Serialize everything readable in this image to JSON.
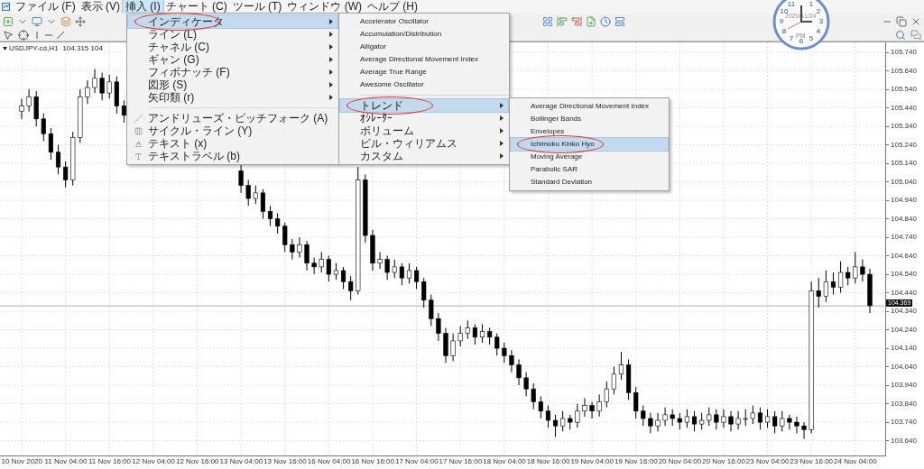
{
  "menubar": [
    {
      "label": "ファイル (F)",
      "selected": false
    },
    {
      "label": "表示 (V)",
      "selected": false
    },
    {
      "label": "挿入 (I)",
      "selected": true
    },
    {
      "label": "チャート (C)",
      "selected": false
    },
    {
      "label": "ツール (T)",
      "selected": false
    },
    {
      "label": "ウィンドウ (W)",
      "selected": false
    },
    {
      "label": "ヘルプ (H)",
      "selected": false
    }
  ],
  "insert_menu": [
    {
      "label": "インディケータ",
      "kind": "submenu",
      "selected": true,
      "circled": true
    },
    {
      "label": "ライン (L)",
      "kind": "submenu",
      "selected": false,
      "circled": false
    },
    {
      "label": "チャネル (C)",
      "kind": "submenu",
      "selected": false,
      "circled": false
    },
    {
      "label": "ギャン (G)",
      "kind": "submenu",
      "selected": false,
      "circled": false
    },
    {
      "label": "フィボナッチ (F)",
      "kind": "submenu",
      "selected": false,
      "circled": false
    },
    {
      "label": "図形 (S)",
      "kind": "submenu",
      "selected": false,
      "circled": false
    },
    {
      "label": "矢印類 (r)",
      "kind": "submenu",
      "selected": false,
      "circled": false
    },
    {
      "kind": "separator"
    },
    {
      "label": "アンドリューズ・ピッチフォーク (A)",
      "kind": "tool",
      "selected": false,
      "circled": false
    },
    {
      "label": "サイクル・ライン (Y)",
      "kind": "tool",
      "selected": false,
      "circled": false
    },
    {
      "label": "テキスト (x)",
      "kind": "tool",
      "selected": false,
      "circled": false
    },
    {
      "label": "テキストラベル (b)",
      "kind": "tool",
      "selected": false,
      "circled": false
    }
  ],
  "indicator_menu": [
    {
      "label": "Accelerator Oscillator",
      "kind": "item",
      "selected": false,
      "circled": false
    },
    {
      "label": "Accumulation/Distribution",
      "kind": "item",
      "selected": false,
      "circled": false
    },
    {
      "label": "Alligator",
      "kind": "item",
      "selected": false,
      "circled": false
    },
    {
      "label": "Average Directional Movement Index",
      "kind": "item",
      "selected": false,
      "circled": false
    },
    {
      "label": "Average True Range",
      "kind": "item",
      "selected": false,
      "circled": false
    },
    {
      "label": "Awesome Oscillator",
      "kind": "item",
      "selected": false,
      "circled": false
    },
    {
      "kind": "separator"
    },
    {
      "label": "トレンド",
      "kind": "submenu",
      "selected": true,
      "circled": true
    },
    {
      "label": "ｵｼﾚｰﾀｰ",
      "kind": "submenu",
      "selected": false,
      "circled": false
    },
    {
      "label": "ボリューム",
      "kind": "submenu",
      "selected": false,
      "circled": false
    },
    {
      "label": "ビル・ウィリアムス",
      "kind": "submenu",
      "selected": false,
      "circled": false
    },
    {
      "label": "カスタム",
      "kind": "submenu",
      "selected": false,
      "circled": false
    }
  ],
  "trend_menu": [
    {
      "label": "Average Directional Movement Index",
      "kind": "item",
      "selected": false,
      "circled": false
    },
    {
      "label": "Bollinger Bands",
      "kind": "item",
      "selected": false,
      "circled": false
    },
    {
      "label": "Envelopes",
      "kind": "item",
      "selected": false,
      "circled": false
    },
    {
      "label": "Ichimoku Kinko Hyo",
      "kind": "item",
      "selected": true,
      "circled": true
    },
    {
      "label": "Moving Average",
      "kind": "item",
      "selected": false,
      "circled": false
    },
    {
      "label": "Parabolic SAR",
      "kind": "item",
      "selected": false,
      "circled": false
    },
    {
      "label": "Standard Deviation",
      "kind": "item",
      "selected": false,
      "circled": false
    }
  ],
  "chart": {
    "symbol": "USDJPY-cd,H1",
    "prices": "104.315 104",
    "chart_data": {
      "type": "candlestick",
      "ylim": [
        103.56,
        105.794
      ],
      "grid": true,
      "ref_lines": [
        {
          "axis": "y",
          "value": 104.369,
          "label": "104.369",
          "color": "#999999"
        }
      ],
      "categories": [
        "10 Nov 2020",
        null,
        null,
        null,
        null,
        null,
        "11 Nov 04:00",
        null,
        null,
        null,
        null,
        null,
        "11 Nov 16:00",
        null,
        null,
        null,
        null,
        null,
        "12 Nov 04:00",
        null,
        null,
        null,
        null,
        null,
        "12 Nov 16:00",
        null,
        null,
        null,
        null,
        null,
        "13 Nov 04:00",
        null,
        null,
        null,
        null,
        null,
        "13 Nov 16:00",
        null,
        null,
        null,
        null,
        null,
        "16 Nov 04:00",
        null,
        null,
        null,
        null,
        null,
        "16 Nov 16:00",
        null,
        null,
        null,
        null,
        null,
        "17 Nov 04:00",
        null,
        null,
        null,
        null,
        null,
        "17 Nov 16:00",
        null,
        null,
        null,
        null,
        null,
        "18 Nov 04:00",
        null,
        null,
        null,
        null,
        null,
        "18 Nov 16:00",
        null,
        null,
        null,
        null,
        null,
        "19 Nov 04:00",
        null,
        null,
        null,
        null,
        null,
        "19 Nov 16:00",
        null,
        null,
        null,
        null,
        null,
        "20 Nov 04:00",
        null,
        null,
        null,
        null,
        null,
        "20 Nov 16:00",
        null,
        null,
        null,
        null,
        null,
        "23 Nov 04:00",
        null,
        null,
        null,
        null,
        null,
        "23 Nov 16:00",
        null,
        null,
        null,
        null,
        null,
        "24 Nov 04:00",
        null,
        null
      ],
      "yticks": [
        {
          "value": 105.74,
          "label": "105.740"
        },
        {
          "value": 105.64,
          "label": "105.640"
        },
        {
          "value": 105.54,
          "label": "105.540"
        },
        {
          "value": 105.44,
          "label": "105.440"
        },
        {
          "value": 105.34,
          "label": "105.340"
        },
        {
          "value": 105.24,
          "label": "105.240"
        },
        {
          "value": 105.14,
          "label": "105.140"
        },
        {
          "value": 105.04,
          "label": "105.040"
        },
        {
          "value": 104.94,
          "label": "104.940"
        },
        {
          "value": 104.84,
          "label": "104.840"
        },
        {
          "value": 104.74,
          "label": "104.740"
        },
        {
          "value": 104.64,
          "label": "104.640"
        },
        {
          "value": 104.54,
          "label": "104.540"
        },
        {
          "value": 104.44,
          "label": "104.440"
        },
        {
          "value": 104.34,
          "label": "104.340"
        },
        {
          "value": 104.24,
          "label": "104.240"
        },
        {
          "value": 104.14,
          "label": "104.140"
        },
        {
          "value": 104.04,
          "label": "104.040"
        },
        {
          "value": 103.94,
          "label": "103.940"
        },
        {
          "value": 103.84,
          "label": "103.840"
        },
        {
          "value": 103.74,
          "label": "103.740"
        },
        {
          "value": 103.64,
          "label": "103.640"
        }
      ],
      "ohlc": [
        [
          105.42,
          105.49,
          105.38,
          105.45
        ],
        [
          105.45,
          105.54,
          105.42,
          105.5
        ],
        [
          105.5,
          105.53,
          105.34,
          105.38
        ],
        [
          105.38,
          105.41,
          105.26,
          105.3
        ],
        [
          105.3,
          105.33,
          105.16,
          105.2
        ],
        [
          105.2,
          105.24,
          105.08,
          105.12
        ],
        [
          105.12,
          105.15,
          105.01,
          105.05
        ],
        [
          105.05,
          105.31,
          105.02,
          105.28
        ],
        [
          105.28,
          105.54,
          105.25,
          105.5
        ],
        [
          105.5,
          105.59,
          105.46,
          105.55
        ],
        [
          105.55,
          105.65,
          105.52,
          105.6
        ],
        [
          105.6,
          105.63,
          105.48,
          105.52
        ],
        [
          105.52,
          105.62,
          105.49,
          105.58
        ],
        [
          105.58,
          105.61,
          105.41,
          105.45
        ],
        [
          105.45,
          105.48,
          105.36,
          105.4
        ],
        null,
        null,
        null,
        null,
        null,
        null,
        null,
        null,
        null,
        null,
        null,
        null,
        null,
        null,
        null,
        [
          105.1,
          105.13,
          104.98,
          105.02
        ],
        [
          105.02,
          105.05,
          104.91,
          104.95
        ],
        [
          104.95,
          105.02,
          104.92,
          104.98
        ],
        [
          104.98,
          105.0,
          104.84,
          104.88
        ],
        [
          104.88,
          104.91,
          104.8,
          104.84
        ],
        [
          104.84,
          104.87,
          104.76,
          104.8
        ],
        [
          104.8,
          104.82,
          104.66,
          104.7
        ],
        [
          104.7,
          104.73,
          104.62,
          104.66
        ],
        [
          104.66,
          104.74,
          104.63,
          104.7
        ],
        [
          104.7,
          104.72,
          104.56,
          104.6
        ],
        [
          104.6,
          104.63,
          104.54,
          104.58
        ],
        [
          104.58,
          104.66,
          104.55,
          104.62
        ],
        [
          104.62,
          104.64,
          104.5,
          104.54
        ],
        [
          104.54,
          104.6,
          104.51,
          104.56
        ],
        [
          104.56,
          104.58,
          104.46,
          104.5
        ],
        [
          104.5,
          104.53,
          104.4,
          104.45
        ],
        [
          104.45,
          105.12,
          104.43,
          105.05
        ],
        [
          105.05,
          105.08,
          104.71,
          104.75
        ],
        [
          104.75,
          104.78,
          104.56,
          104.6
        ],
        [
          104.6,
          104.66,
          104.57,
          104.62
        ],
        [
          104.62,
          104.64,
          104.51,
          104.55
        ],
        [
          104.55,
          104.62,
          104.52,
          104.58
        ],
        [
          104.58,
          104.6,
          104.48,
          104.52
        ],
        [
          104.52,
          104.6,
          104.49,
          104.56
        ],
        [
          104.56,
          104.58,
          104.46,
          104.5
        ],
        [
          104.5,
          104.52,
          104.36,
          104.4
        ],
        [
          104.4,
          104.43,
          104.26,
          104.3
        ],
        [
          104.3,
          104.33,
          104.18,
          104.22
        ],
        [
          104.22,
          104.25,
          104.06,
          104.1
        ],
        [
          104.1,
          104.22,
          104.07,
          104.18
        ],
        [
          104.18,
          104.26,
          104.15,
          104.22
        ],
        [
          104.22,
          104.29,
          104.19,
          104.25
        ],
        [
          104.25,
          104.27,
          104.16,
          104.2
        ],
        [
          104.2,
          104.27,
          104.17,
          104.23
        ],
        [
          104.23,
          104.25,
          104.16,
          104.2
        ],
        [
          104.2,
          104.22,
          104.1,
          104.14
        ],
        [
          104.14,
          104.17,
          104.06,
          104.1
        ],
        [
          104.1,
          104.13,
          104.01,
          104.05
        ],
        [
          104.05,
          104.08,
          103.94,
          103.98
        ],
        [
          103.98,
          104.01,
          103.88,
          103.92
        ],
        [
          103.92,
          103.95,
          103.81,
          103.85
        ],
        [
          103.85,
          103.88,
          103.76,
          103.8
        ],
        [
          103.8,
          103.83,
          103.71,
          103.75
        ],
        [
          103.75,
          103.78,
          103.66,
          103.72
        ],
        [
          103.72,
          103.8,
          103.69,
          103.76
        ],
        [
          103.76,
          103.78,
          103.7,
          103.74
        ],
        [
          103.74,
          103.84,
          103.71,
          103.8
        ],
        [
          103.8,
          103.87,
          103.77,
          103.83
        ],
        [
          103.83,
          103.85,
          103.76,
          103.8
        ],
        [
          103.8,
          103.89,
          103.77,
          103.85
        ],
        [
          103.85,
          103.96,
          103.82,
          103.92
        ],
        [
          103.92,
          104.04,
          103.89,
          104.0
        ],
        [
          104.0,
          104.12,
          103.97,
          104.05
        ],
        [
          104.05,
          104.08,
          103.86,
          103.9
        ],
        [
          103.9,
          103.93,
          103.76,
          103.8
        ],
        [
          103.8,
          103.83,
          103.72,
          103.76
        ],
        [
          103.76,
          103.79,
          103.68,
          103.72
        ],
        [
          103.72,
          103.79,
          103.69,
          103.75
        ],
        [
          103.75,
          103.82,
          103.72,
          103.78
        ],
        [
          103.78,
          103.81,
          103.72,
          103.76
        ],
        [
          103.76,
          103.79,
          103.7,
          103.74
        ],
        [
          103.74,
          103.81,
          103.71,
          103.77
        ],
        [
          103.77,
          103.8,
          103.69,
          103.73
        ],
        [
          103.73,
          103.79,
          103.7,
          103.75
        ],
        [
          103.75,
          103.82,
          103.72,
          103.78
        ],
        [
          103.78,
          103.81,
          103.7,
          103.74
        ],
        [
          103.74,
          103.81,
          103.71,
          103.77
        ],
        [
          103.77,
          103.8,
          103.69,
          103.73
        ],
        [
          103.73,
          103.8,
          103.7,
          103.76
        ],
        [
          103.76,
          103.81,
          103.72,
          103.76
        ],
        [
          103.76,
          103.83,
          103.73,
          103.79
        ],
        [
          103.79,
          103.82,
          103.7,
          103.74
        ],
        [
          103.74,
          103.81,
          103.71,
          103.77
        ],
        [
          103.77,
          103.8,
          103.68,
          103.72
        ],
        [
          103.72,
          103.8,
          103.69,
          103.76
        ],
        [
          103.76,
          103.78,
          103.7,
          103.74
        ],
        [
          103.74,
          103.77,
          103.68,
          103.72
        ],
        [
          103.72,
          103.74,
          103.65,
          103.7
        ],
        [
          103.7,
          104.5,
          103.68,
          104.45
        ],
        [
          104.45,
          104.52,
          104.36,
          104.42
        ],
        [
          104.42,
          104.56,
          104.39,
          104.5
        ],
        [
          104.5,
          104.55,
          104.43,
          104.47
        ],
        [
          104.47,
          104.61,
          104.44,
          104.55
        ],
        [
          104.55,
          104.58,
          104.48,
          104.52
        ],
        [
          104.52,
          104.66,
          104.49,
          104.58
        ],
        [
          104.58,
          104.62,
          104.5,
          104.54
        ],
        [
          104.54,
          104.57,
          104.33,
          104.37
        ]
      ]
    }
  },
  "clock": {
    "date": "2020/11/24",
    "period": "PM",
    "numerals": [
      "11",
      "1",
      "10",
      "2",
      "9",
      "3",
      "8",
      "4",
      "7",
      "5",
      "6"
    ]
  }
}
